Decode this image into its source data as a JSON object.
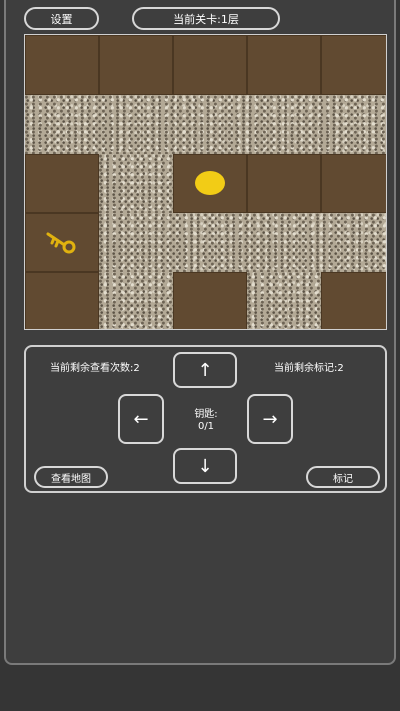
{
  "header": {
    "settings_label": "设置",
    "level_label": "当前关卡:1层"
  },
  "map": {
    "items": [
      "coin",
      "key-icon"
    ]
  },
  "controls": {
    "remaining_views": "当前剩余查看次数:2",
    "remaining_marks": "当前剩余标记:2",
    "keys_label": "钥匙:",
    "keys_value": "0/1",
    "up": "↑",
    "down": "↓",
    "left": "←",
    "right": "→",
    "view_map_label": "查看地图",
    "mark_label": "标记"
  },
  "colors": {
    "dirt": "#614a31",
    "coin": "#f2cc16",
    "key": "#e0b20f"
  }
}
